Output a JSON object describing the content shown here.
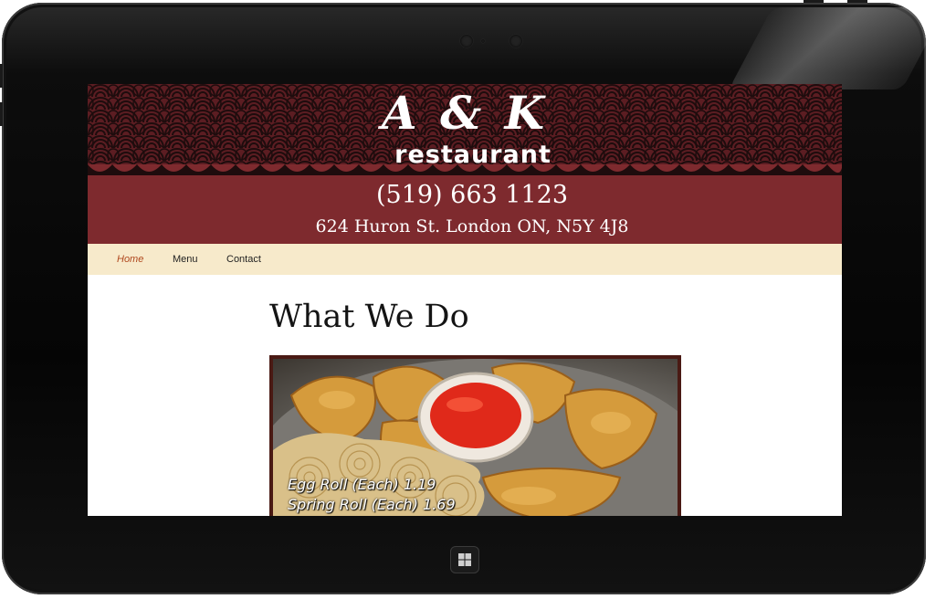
{
  "logo": {
    "main": "A & K",
    "sub": "restaurant"
  },
  "contact": {
    "phone": "(519) 663 1123",
    "address": "624 Huron St. London ON, N5Y 4J8"
  },
  "nav": {
    "items": [
      {
        "label": "Home",
        "active": true
      },
      {
        "label": "Menu",
        "active": false
      },
      {
        "label": "Contact",
        "active": false
      }
    ]
  },
  "page": {
    "heading": "What We Do"
  },
  "promo": {
    "lines": [
      "Egg Roll (Each) 1.19",
      "Spring Roll (Each) 1.69"
    ]
  },
  "colors": {
    "banner": "#7e2a2e",
    "nav_bg": "#f7eacb",
    "nav_active": "#b0491f"
  },
  "icons": {
    "home_key": "windows-logo-icon",
    "camera": "camera-icon"
  }
}
